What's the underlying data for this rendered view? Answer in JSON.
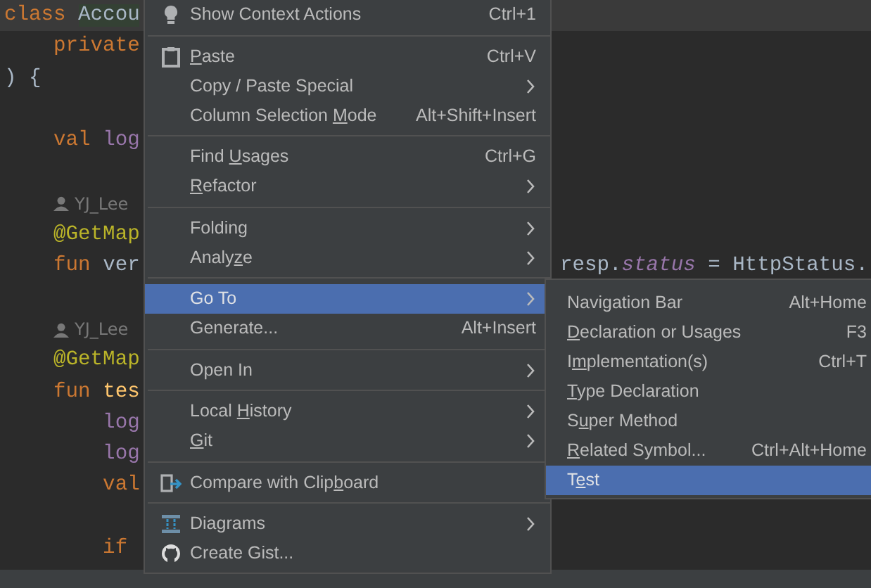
{
  "editor": {
    "lines": [
      {
        "kind": "code",
        "current": true,
        "segments": [
          {
            "text": "class ",
            "kind": "keyword"
          },
          {
            "text": "Accou",
            "kind": "highlight"
          }
        ]
      },
      {
        "kind": "code",
        "segments": [
          {
            "text": "    private",
            "kind": "keyword"
          }
        ]
      },
      {
        "kind": "code",
        "segments": [
          {
            "text": ") {",
            "kind": "plain"
          }
        ]
      },
      {
        "kind": "blank"
      },
      {
        "kind": "code",
        "segments": [
          {
            "text": "    val ",
            "kind": "keyword"
          },
          {
            "text": "log",
            "kind": "property"
          }
        ]
      },
      {
        "kind": "blank"
      },
      {
        "kind": "author",
        "text": "YJ_Lee"
      },
      {
        "kind": "code",
        "segments": [
          {
            "text": "    @GetMap",
            "kind": "annotation"
          }
        ]
      },
      {
        "kind": "code",
        "segments": [
          {
            "text": "    fun ",
            "kind": "keyword"
          },
          {
            "text": "ver",
            "kind": "plain"
          }
        ],
        "tail": [
          {
            "text": "resp.",
            "kind": "plain"
          },
          {
            "text": "status",
            "kind": "property_italic"
          },
          {
            "text": " = HttpStatus.",
            "kind": "plain"
          }
        ]
      },
      {
        "kind": "blank"
      },
      {
        "kind": "author",
        "text": "YJ_Lee"
      },
      {
        "kind": "code",
        "segments": [
          {
            "text": "    @GetMap",
            "kind": "annotation"
          }
        ]
      },
      {
        "kind": "code",
        "segments": [
          {
            "text": "    fun ",
            "kind": "keyword"
          },
          {
            "text": "tes",
            "kind": "function"
          }
        ]
      },
      {
        "kind": "code",
        "segments": [
          {
            "text": "        log",
            "kind": "property"
          }
        ]
      },
      {
        "kind": "code",
        "segments": [
          {
            "text": "        log",
            "kind": "property"
          }
        ]
      },
      {
        "kind": "code",
        "segments": [
          {
            "text": "        val",
            "kind": "keyword"
          }
        ]
      },
      {
        "kind": "blank"
      },
      {
        "kind": "code",
        "segments": [
          {
            "text": "        if",
            "kind": "keyword"
          }
        ]
      }
    ]
  },
  "context_menu": {
    "items": [
      {
        "kind": "item",
        "label": {
          "pre": "Show Context Actions"
        },
        "shortcut": "Ctrl+1",
        "submenu": false,
        "selected": false
      },
      {
        "kind": "separator"
      },
      {
        "kind": "item",
        "label": {
          "key": "P",
          "post": "aste"
        },
        "shortcut": "Ctrl+V",
        "submenu": false,
        "selected": false
      },
      {
        "kind": "item",
        "label": {
          "pre": "Copy / Paste Special"
        },
        "submenu": true,
        "selected": false
      },
      {
        "kind": "item",
        "label": {
          "pre": "Column Selection ",
          "key": "M",
          "post": "ode"
        },
        "shortcut": "Alt+Shift+Insert",
        "submenu": false,
        "selected": false
      },
      {
        "kind": "separator"
      },
      {
        "kind": "item",
        "label": {
          "pre": "Find ",
          "key": "U",
          "post": "sages"
        },
        "shortcut": "Ctrl+G",
        "submenu": false,
        "selected": false
      },
      {
        "kind": "item",
        "label": {
          "key": "R",
          "post": "efactor"
        },
        "submenu": true,
        "selected": false
      },
      {
        "kind": "separator"
      },
      {
        "kind": "item",
        "label": {
          "pre": "Folding"
        },
        "submenu": true,
        "selected": false
      },
      {
        "kind": "item",
        "label": {
          "pre": "Analy",
          "key": "z",
          "post": "e"
        },
        "submenu": true,
        "selected": false
      },
      {
        "kind": "separator"
      },
      {
        "kind": "item",
        "label": {
          "pre": "Go To"
        },
        "submenu": true,
        "selected": true
      },
      {
        "kind": "item",
        "label": {
          "pre": "Generate..."
        },
        "shortcut": "Alt+Insert",
        "submenu": false,
        "selected": false
      },
      {
        "kind": "separator"
      },
      {
        "kind": "item",
        "label": {
          "pre": "Open In"
        },
        "submenu": true,
        "selected": false
      },
      {
        "kind": "separator"
      },
      {
        "kind": "item",
        "label": {
          "pre": "Local ",
          "key": "H",
          "post": "istory"
        },
        "submenu": true,
        "selected": false
      },
      {
        "kind": "item",
        "label": {
          "key": "G",
          "post": "it"
        },
        "submenu": true,
        "selected": false
      },
      {
        "kind": "separator"
      },
      {
        "kind": "item",
        "label": {
          "pre": "Compare with Clip",
          "key": "b",
          "post": "oard"
        },
        "submenu": false,
        "selected": false
      },
      {
        "kind": "separator"
      },
      {
        "kind": "item",
        "label": {
          "pre": "Diagrams"
        },
        "submenu": true,
        "selected": false
      },
      {
        "kind": "item",
        "label": {
          "pre": "Create Gist..."
        },
        "submenu": false,
        "selected": false
      }
    ]
  },
  "submenu": {
    "items": [
      {
        "label": {
          "pre": "Navigation Bar"
        },
        "shortcut": "Alt+Home",
        "selected": false
      },
      {
        "label": {
          "key": "D",
          "post": "eclaration or Usages"
        },
        "shortcut": "F3",
        "selected": false
      },
      {
        "label": {
          "pre": "I",
          "key": "m",
          "post": "plementation(s)"
        },
        "shortcut": "Ctrl+T",
        "selected": false
      },
      {
        "label": {
          "key": "T",
          "post": "ype Declaration"
        },
        "selected": false
      },
      {
        "label": {
          "pre": "S",
          "key": "u",
          "post": "per Method"
        },
        "selected": false
      },
      {
        "label": {
          "key": "R",
          "post": "elated Symbol..."
        },
        "shortcut": "Ctrl+Alt+Home",
        "selected": false
      },
      {
        "label": {
          "pre": "T",
          "key": "e",
          "post": "st"
        },
        "selected": true
      }
    ]
  }
}
